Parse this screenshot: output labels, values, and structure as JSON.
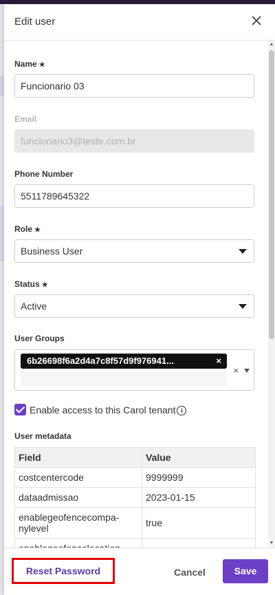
{
  "dialog": {
    "title": "Edit user",
    "close_icon": "close-icon"
  },
  "form": {
    "name": {
      "label": "Name",
      "required_mark": "★",
      "value": "Funcionario 03"
    },
    "email": {
      "label": "Email",
      "value": "funcionario3@teste.com.br"
    },
    "phone": {
      "label": "Phone Number",
      "value": "5511789645322"
    },
    "role": {
      "label": "Role",
      "required_mark": "★",
      "value": "Business User"
    },
    "status": {
      "label": "Status",
      "required_mark": "★",
      "value": "Active"
    },
    "user_groups": {
      "label": "User Groups",
      "chip": "6b26698f6a2d4a7c8f57d9f976941...",
      "chip_remove": "×",
      "clear": "×"
    },
    "access": {
      "label": "Enable access to this Carol tenant",
      "checked": true,
      "info_icon": "info-icon"
    }
  },
  "metadata": {
    "label": "User metadata",
    "headers": [
      "Field",
      "Value"
    ],
    "rows": [
      {
        "field": "costcentercode",
        "value": "9999999"
      },
      {
        "field": "dataadmissao",
        "value": "2023-01-15"
      },
      {
        "field": "enablegeofencecompa-nylevel",
        "value": "true"
      },
      {
        "field": "enablegeofencelocation",
        "value": ""
      }
    ]
  },
  "footer": {
    "reset": "Reset Password",
    "cancel": "Cancel",
    "save": "Save"
  },
  "colors": {
    "accent": "#6c3fc6",
    "highlight": "#e60000"
  }
}
